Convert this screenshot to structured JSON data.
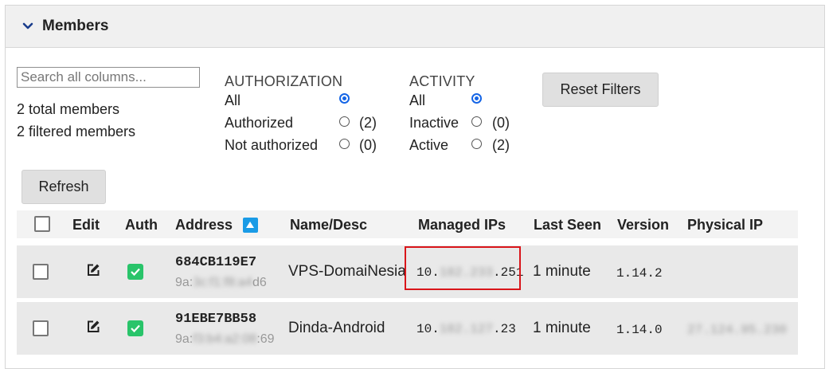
{
  "panel": {
    "title": "Members",
    "icon": "chevron-down-icon"
  },
  "search": {
    "placeholder": "Search all columns...",
    "value": ""
  },
  "stats": {
    "total": "2 total members",
    "filtered": "2 filtered members"
  },
  "authorization": {
    "title": "AUTHORIZATION",
    "options": [
      {
        "label": "All",
        "count": "",
        "selected": true
      },
      {
        "label": "Authorized",
        "count": "(2)",
        "selected": false
      },
      {
        "label": "Not authorized",
        "count": "(0)",
        "selected": false
      }
    ]
  },
  "activity": {
    "title": "ACTIVITY",
    "options": [
      {
        "label": "All",
        "count": "",
        "selected": true
      },
      {
        "label": "Inactive",
        "count": "(0)",
        "selected": false
      },
      {
        "label": "Active",
        "count": "(2)",
        "selected": false
      }
    ]
  },
  "buttons": {
    "reset": "Reset Filters",
    "refresh": "Refresh"
  },
  "table": {
    "headers": [
      "Edit",
      "Auth",
      "Address",
      "Name/Desc",
      "Managed IPs",
      "Last Seen",
      "Version",
      "Physical IP"
    ],
    "sort_icon": "sort-ascending-icon",
    "rows": [
      {
        "address": "684CB119E7",
        "address_sub_start": "9a:",
        "address_sub_hidden": "3c:f1:f8:a4",
        "address_sub_end": "d6",
        "name": "VPS-DomaiNesia",
        "ip_start": "10.",
        "ip_hidden": "182.233",
        "ip_end": ".251",
        "last_seen": "1 minute",
        "version": "1.14.2",
        "physical_ip": "",
        "auth_checked": true
      },
      {
        "address": "91EBE7BB58",
        "address_sub_start": "9a:",
        "address_sub_hidden": "f3:b4:a2:08",
        "address_sub_end": ":69",
        "name": "Dinda-Android",
        "ip_start": "10.",
        "ip_hidden": "182.127",
        "ip_end": ".23",
        "last_seen": "1 minute",
        "version": "1.14.0",
        "physical_ip": "27.124.95.230",
        "auth_checked": true
      }
    ]
  },
  "colors": {
    "accent": "#1565e6",
    "auth_green": "#29c46a",
    "highlight": "#d9151a",
    "sort_blue": "#1a9be6"
  }
}
